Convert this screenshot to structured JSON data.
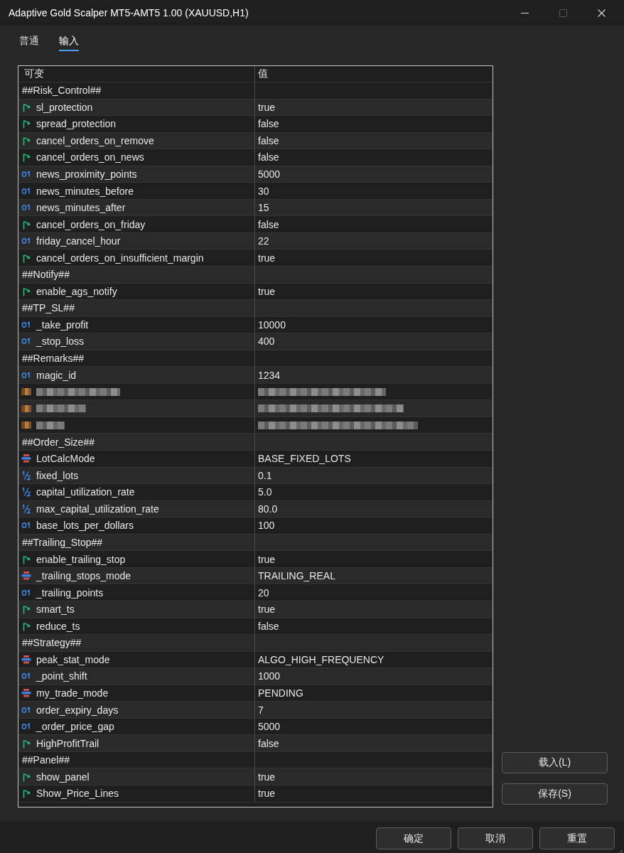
{
  "window": {
    "title": "Adaptive Gold Scalper MT5-AMT5 1.00 (XAUUSD,H1)",
    "maximize_disabled": true
  },
  "tabs": [
    {
      "label": "普通",
      "selected": false
    },
    {
      "label": "输入",
      "selected": true
    }
  ],
  "table": {
    "columns": [
      "可变",
      "值"
    ],
    "rows": [
      {
        "kind": "section",
        "name": "##Risk_Control##"
      },
      {
        "kind": "bool",
        "name": "sl_protection",
        "value": "true"
      },
      {
        "kind": "bool",
        "name": "spread_protection",
        "value": "false"
      },
      {
        "kind": "bool",
        "name": "cancel_orders_on_remove",
        "value": "false"
      },
      {
        "kind": "bool",
        "name": "cancel_orders_on_news",
        "value": "false"
      },
      {
        "kind": "int",
        "name": "news_proximity_points",
        "value": "5000"
      },
      {
        "kind": "int",
        "name": "news_minutes_before",
        "value": "30"
      },
      {
        "kind": "int",
        "name": "news_minutes_after",
        "value": "15"
      },
      {
        "kind": "bool",
        "name": "cancel_orders_on_friday",
        "value": "false"
      },
      {
        "kind": "int",
        "name": "friday_cancel_hour",
        "value": "22"
      },
      {
        "kind": "bool",
        "name": "cancel_orders_on_insufficient_margin",
        "value": "true"
      },
      {
        "kind": "section",
        "name": "##Notify##"
      },
      {
        "kind": "bool",
        "name": "enable_ags_notify",
        "value": "true"
      },
      {
        "kind": "section",
        "name": "##TP_SL##"
      },
      {
        "kind": "int",
        "name": "_take_profit",
        "value": "10000"
      },
      {
        "kind": "int",
        "name": "_stop_loss",
        "value": "400"
      },
      {
        "kind": "section",
        "name": "##Remarks##"
      },
      {
        "kind": "int",
        "name": "magic_id",
        "value": "1234"
      },
      {
        "kind": "redacted"
      },
      {
        "kind": "redacted"
      },
      {
        "kind": "redacted"
      },
      {
        "kind": "section",
        "name": "##Order_Size##"
      },
      {
        "kind": "enum",
        "name": "LotCalcMode",
        "value": "BASE_FIXED_LOTS"
      },
      {
        "kind": "double",
        "name": "fixed_lots",
        "value": "0.1"
      },
      {
        "kind": "double",
        "name": "capital_utilization_rate",
        "value": "5.0"
      },
      {
        "kind": "double",
        "name": "max_capital_utilization_rate",
        "value": "80.0"
      },
      {
        "kind": "int",
        "name": "base_lots_per_dollars",
        "value": "100"
      },
      {
        "kind": "section",
        "name": "##Trailing_Stop##"
      },
      {
        "kind": "bool",
        "name": "enable_trailing_stop",
        "value": "true"
      },
      {
        "kind": "enum",
        "name": "_trailing_stops_mode",
        "value": "TRAILING_REAL"
      },
      {
        "kind": "int",
        "name": "_trailing_points",
        "value": "20"
      },
      {
        "kind": "bool",
        "name": "smart_ts",
        "value": "true"
      },
      {
        "kind": "bool",
        "name": "reduce_ts",
        "value": "false"
      },
      {
        "kind": "section",
        "name": "##Strategy##"
      },
      {
        "kind": "enum",
        "name": "peak_stat_mode",
        "value": "ALGO_HIGH_FREQUENCY"
      },
      {
        "kind": "int",
        "name": "_point_shift",
        "value": "1000"
      },
      {
        "kind": "enum",
        "name": "my_trade_mode",
        "value": "PENDING"
      },
      {
        "kind": "int",
        "name": "order_expiry_days",
        "value": "7"
      },
      {
        "kind": "int",
        "name": "_order_price_gap",
        "value": "5000"
      },
      {
        "kind": "bool",
        "name": "HighProfitTrail",
        "value": "false"
      },
      {
        "kind": "section",
        "name": "##Panel##"
      },
      {
        "kind": "bool",
        "name": "show_panel",
        "value": "true"
      },
      {
        "kind": "bool",
        "name": "Show_Price_Lines",
        "value": "true"
      }
    ]
  },
  "side_buttons": [
    "载入(L)",
    "保存(S)"
  ],
  "footer_buttons": [
    "确定",
    "取消",
    "重置"
  ]
}
